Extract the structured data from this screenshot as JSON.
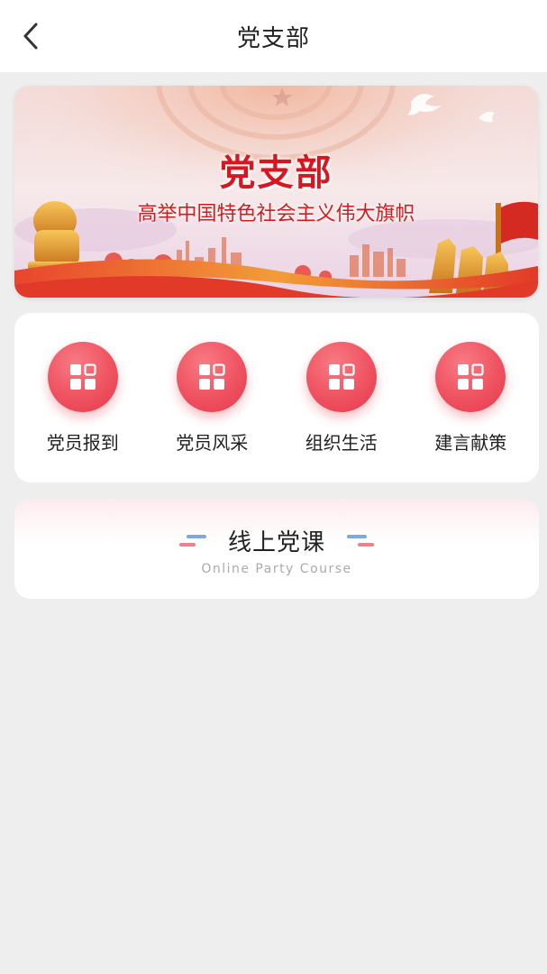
{
  "nav": {
    "title": "党支部"
  },
  "banner": {
    "title": "党支部",
    "subtitle": "高举中国特色社会主义伟大旗帜"
  },
  "menu": {
    "items": [
      {
        "label": "党员报到",
        "icon": "grid-apps-icon"
      },
      {
        "label": "党员风采",
        "icon": "grid-apps-icon"
      },
      {
        "label": "组织生活",
        "icon": "grid-apps-icon"
      },
      {
        "label": "建言献策",
        "icon": "grid-apps-icon"
      }
    ]
  },
  "course": {
    "title": "线上党课",
    "subtitle": "Online Party Course"
  },
  "colors": {
    "accent": "#ef5260",
    "banner_text": "#d9161f",
    "background": "#eeeeee"
  }
}
